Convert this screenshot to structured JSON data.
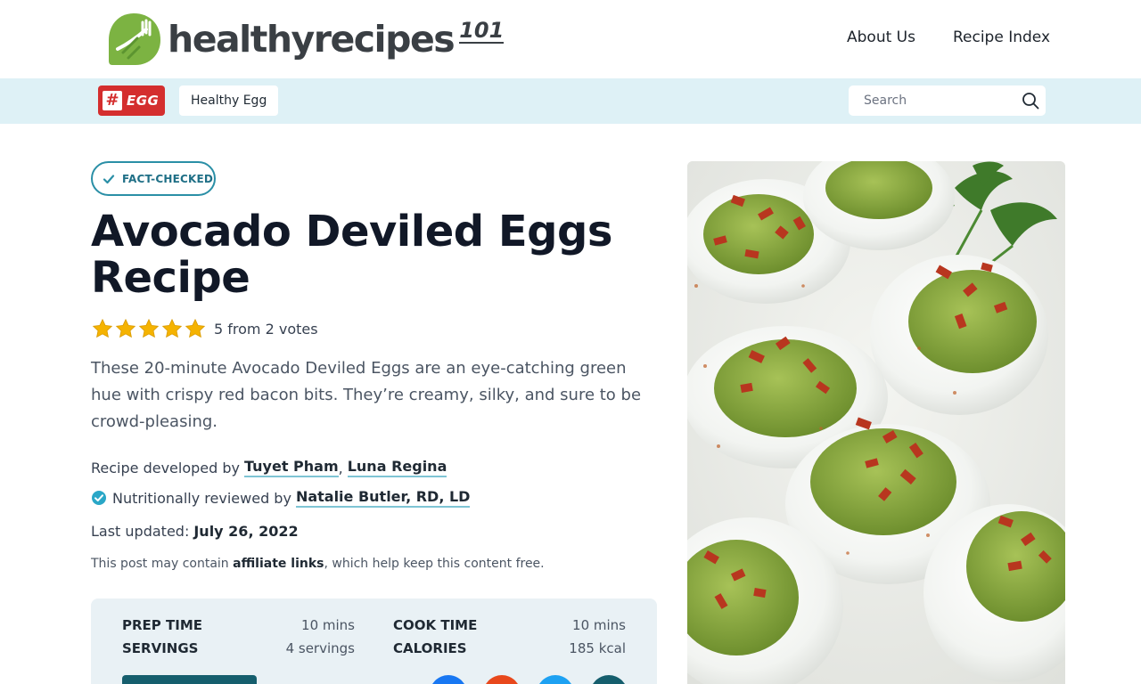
{
  "header": {
    "logo_text": "healthyrecipes",
    "logo_sup": "101",
    "nav": [
      {
        "label": "About Us"
      },
      {
        "label": "Recipe Index"
      }
    ]
  },
  "category_bar": {
    "egg_hash": "#",
    "egg_word": "EGG",
    "chip_label": "Healthy Egg",
    "search_placeholder": "Search"
  },
  "article": {
    "badge": "FACT-CHECKED",
    "title": "Avocado Deviled Eggs Recipe",
    "rating": {
      "stars": 5,
      "text": "5 from 2 votes"
    },
    "summary": "These 20-minute Avocado Deviled Eggs are an eye-catching green hue with crispy red bacon bits. They’re creamy, silky, and sure to be crowd-pleasing.",
    "developed_prefix": "Recipe developed by",
    "developers": [
      "Tuyet Pham",
      "Luna Regina"
    ],
    "developer_sep": ",",
    "reviewed_prefix": "Nutritionally reviewed by",
    "reviewer": "Natalie Butler, RD, LD",
    "updated_prefix": "Last updated:",
    "updated_date": "July 26, 2022",
    "disclaimer_pre": "This post may contain",
    "disclaimer_link": "affiliate links",
    "disclaimer_post": ", which help keep this content free."
  },
  "recipe_info": {
    "prep_label": "PREP TIME",
    "prep_value": "10 mins",
    "cook_label": "COOK TIME",
    "cook_value": "10 mins",
    "servings_label": "SERVINGS",
    "servings_value": "4 servings",
    "calories_label": "CALORIES",
    "calories_value": "185 kcal"
  },
  "colors": {
    "brand_green": "#7cb342",
    "accent_teal": "#2a8fa6",
    "cat_bar_bg": "#def1f6",
    "egg_red": "#d42e2e",
    "star_gold": "#f5b301",
    "share": [
      "#1877f2",
      "#e8481c",
      "#1da1f2",
      "#155e6d"
    ]
  }
}
